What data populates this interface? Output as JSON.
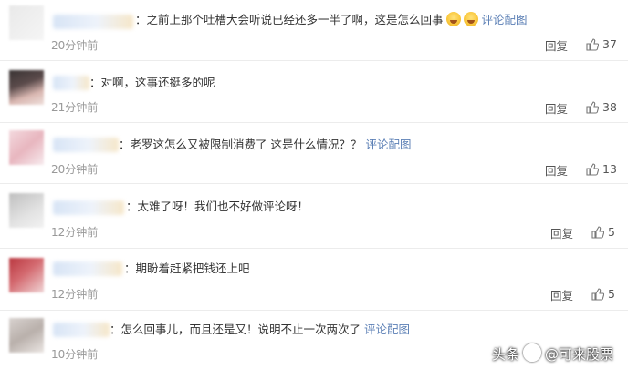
{
  "comments": [
    {
      "text": "：之前上那个吐槽大会听说已经还多一半了啊，这是怎么回事",
      "emoji_count": 2,
      "link": "评论配图",
      "time": "20分钟前",
      "reply_label": "回复",
      "likes": "37"
    },
    {
      "text": "：对啊，这事还挺多的呢",
      "time": "21分钟前",
      "reply_label": "回复",
      "likes": "38"
    },
    {
      "text": "：老罗这怎么又被限制消费了 这是什么情况？？",
      "link": "评论配图",
      "time": "20分钟前",
      "reply_label": "回复",
      "likes": "13"
    },
    {
      "text": "：太难了呀！我们也不好做评论呀！",
      "time": "12分钟前",
      "reply_label": "回复",
      "likes": "5"
    },
    {
      "text": "：期盼着赶紧把钱还上吧",
      "time": "12分钟前",
      "reply_label": "回复",
      "likes": "5"
    },
    {
      "text": "：怎么回事儿，而且还是又！说明不止一次两次了",
      "link": "评论配图",
      "time": "10分钟前",
      "reply_label": "回复"
    }
  ],
  "watermark": {
    "prefix": "头条",
    "handle": "@可来股票"
  },
  "icons": {
    "like": "thumbs-up-icon",
    "emoji": "laughing-emoji-icon"
  },
  "colors": {
    "link": "#5b7fb5",
    "meta": "#999999",
    "divider": "#ececec"
  }
}
